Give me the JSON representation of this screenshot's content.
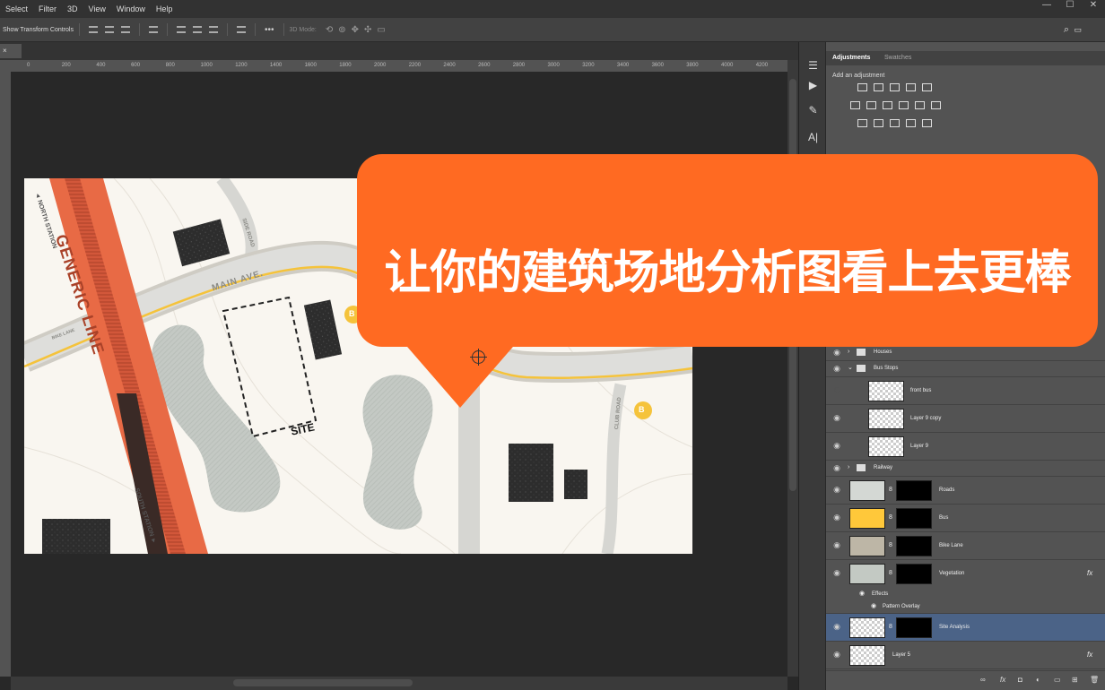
{
  "menu": [
    "Select",
    "Filter",
    "3D",
    "View",
    "Window",
    "Help"
  ],
  "window_controls": [
    "—",
    "☐",
    "✕"
  ],
  "options_bar": {
    "show_transform": "Show Transform Controls",
    "mode_3d": "3D Mode:"
  },
  "document_tab": {
    "label": "×"
  },
  "ruler_ticks": [
    "0",
    "200",
    "400",
    "600",
    "800",
    "1000",
    "1200",
    "1400",
    "1600",
    "1800",
    "2000",
    "2200",
    "2400",
    "2600",
    "2800",
    "3000",
    "3200",
    "3400",
    "3600",
    "3800",
    "4000",
    "4200"
  ],
  "panel": {
    "tab_adjustments": "Adjustments",
    "tab_swatches": "Swatches",
    "add_adjustment": "Add an adjustment"
  },
  "map": {
    "generic_line": "GENERIC LINE",
    "north_station": "◄ NORTH STATION",
    "south_station": "SOUTH STATION ►",
    "main_ave": "MAIN AVE.",
    "side_road": "SIDE ROAD",
    "club_road": "CLUB ROAD",
    "bike_lane": "BIKE LANE",
    "site": "SITE",
    "bus_symbol": "B"
  },
  "layers": [
    {
      "name": "Houses",
      "type": "group"
    },
    {
      "name": "Bus Stops",
      "type": "group-open"
    },
    {
      "name": "front bus",
      "type": "layer"
    },
    {
      "name": "Layer 9 copy",
      "type": "layer"
    },
    {
      "name": "Layer 9",
      "type": "layer"
    },
    {
      "name": "Railway",
      "type": "group"
    },
    {
      "name": "Roads",
      "type": "fill",
      "color": "#d4d8d4"
    },
    {
      "name": "Bus",
      "type": "fill",
      "color": "#ffc83a"
    },
    {
      "name": "Bike Lane",
      "type": "fill",
      "color": "#bdb6a6"
    },
    {
      "name": "Vegetation",
      "type": "fill",
      "color": "#c3c9c3",
      "fx": "fx"
    },
    {
      "name": "Site Analysis",
      "type": "layer"
    },
    {
      "name": "Layer 5",
      "type": "layer",
      "fx": "fx"
    }
  ],
  "effects": {
    "label": "Effects",
    "pattern": "Pattern Overlay"
  },
  "overlay": {
    "title": "让你的建筑场地分析图看上去更棒"
  },
  "colors": {
    "orange": "#ff6a22",
    "railway": "#e86a45",
    "road": "#d6d6d2",
    "bus_yellow": "#f5c33b"
  }
}
